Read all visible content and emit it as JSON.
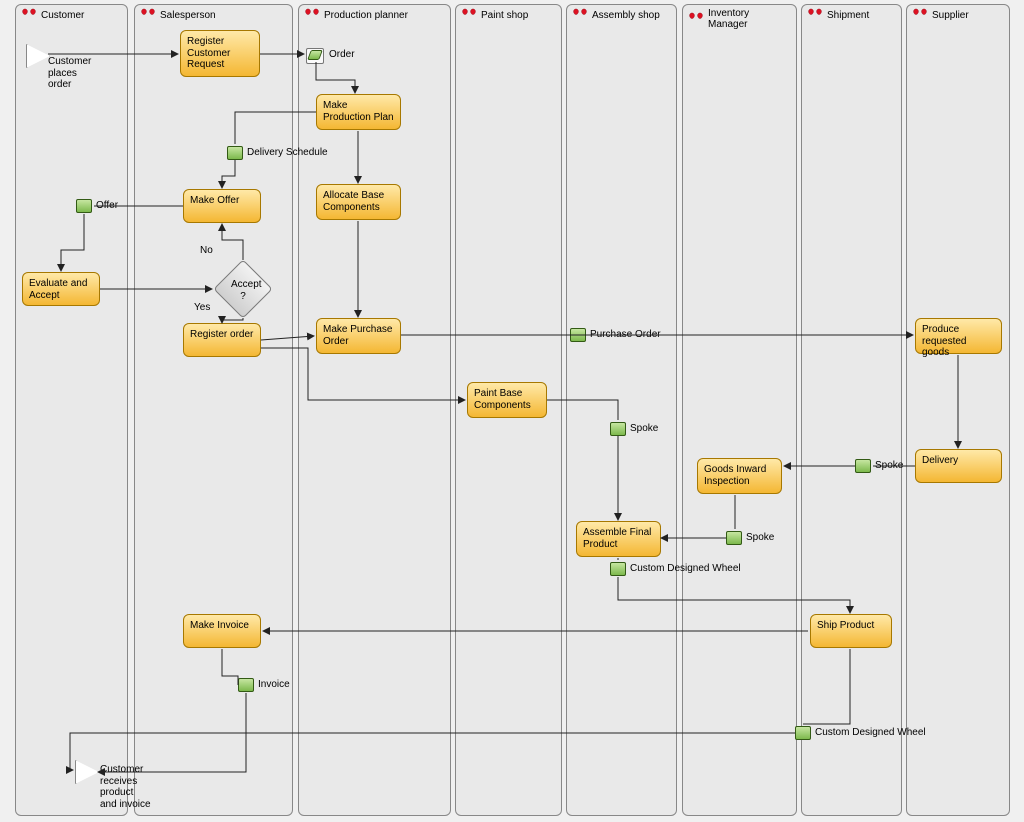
{
  "lanes": {
    "customer": {
      "title": "Customer"
    },
    "sales": {
      "title": "Salesperson"
    },
    "planner": {
      "title": "Production planner"
    },
    "paint": {
      "title": "Paint shop"
    },
    "assembly": {
      "title": "Assembly shop"
    },
    "inventory": {
      "title": "Inventory Manager"
    },
    "shipment": {
      "title": "Shipment"
    },
    "supplier": {
      "title": "Supplier"
    }
  },
  "events": {
    "start": {
      "label": "Customer\nplaces\norder"
    },
    "end": {
      "label": "Customer\nreceives\nproduct\nand invoice"
    }
  },
  "boxes": {
    "register_request": {
      "label": "Register\nCustomer\nRequest"
    },
    "make_prod_plan": {
      "label": "Make Production\nPlan"
    },
    "make_offer": {
      "label": "Make Offer"
    },
    "allocate_base": {
      "label": "Allocate Base\nComponents"
    },
    "evaluate_accept": {
      "label": "Evaluate and\nAccept"
    },
    "register_order": {
      "label": "Register order"
    },
    "make_po": {
      "label": "Make Purchase\nOrder"
    },
    "produce_goods": {
      "label": "Produce\nrequested goods"
    },
    "paint_base": {
      "label": "Paint Base\nComponents"
    },
    "delivery": {
      "label": "Delivery"
    },
    "goods_inward": {
      "label": "Goods Inward\nInspection"
    },
    "assemble_final": {
      "label": "Assemble Final\nProduct"
    },
    "make_invoice": {
      "label": "Make Invoice"
    },
    "ship_product": {
      "label": "Ship Product"
    }
  },
  "decision": {
    "accept": {
      "label": "Accept\n?",
      "yes": "Yes",
      "no": "No"
    }
  },
  "artifacts": {
    "order": {
      "label": "Order"
    },
    "delivery_sched": {
      "label": "Delivery Schedule"
    },
    "offer": {
      "label": "Offer"
    },
    "purchase_order": {
      "label": "Purchase Order"
    },
    "spoke1": {
      "label": "Spoke"
    },
    "spoke2": {
      "label": "Spoke"
    },
    "spoke3": {
      "label": "Spoke"
    },
    "custom_wheel": {
      "label": "Custom Designed Wheel"
    },
    "custom_wheel2": {
      "label": "Custom Designed Wheel"
    },
    "invoice": {
      "label": "Invoice"
    }
  }
}
